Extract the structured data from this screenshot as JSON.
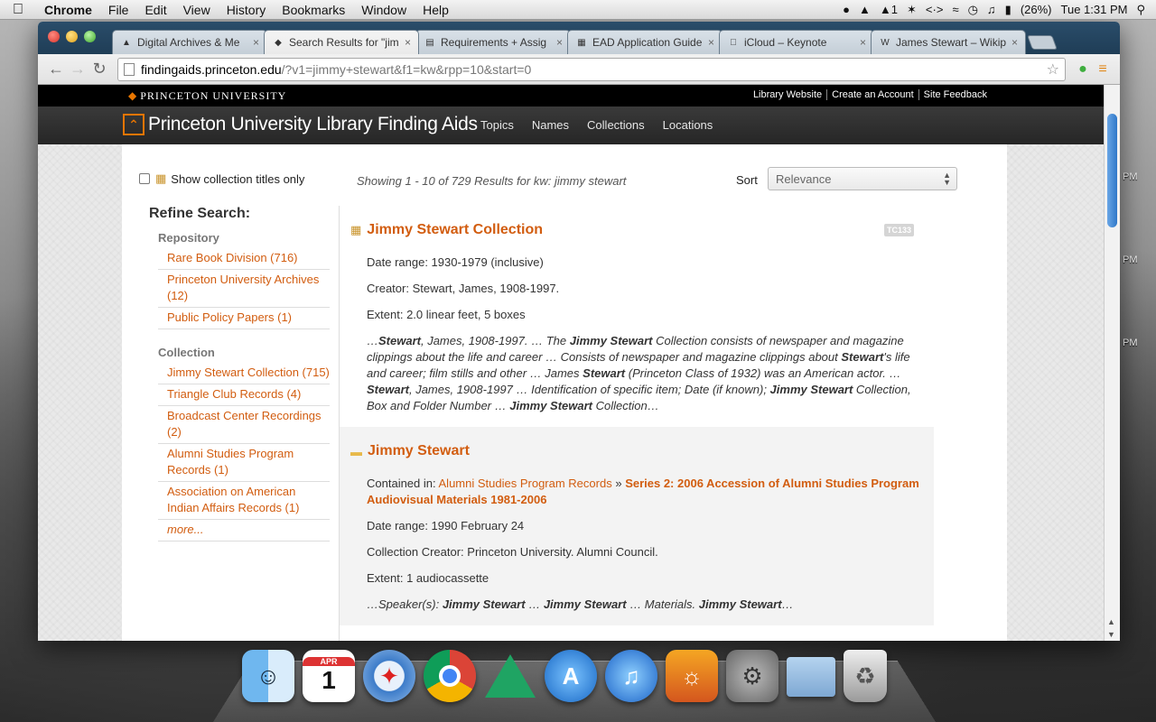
{
  "menubar": {
    "app": "Chrome",
    "items": [
      "File",
      "Edit",
      "View",
      "History",
      "Bookmarks",
      "Window",
      "Help"
    ],
    "status": {
      "adobe_count": "1",
      "battery": "(26%)",
      "clock": "Tue 1:31 PM"
    }
  },
  "browser": {
    "tabs": [
      {
        "label": "Digital Archives & Me",
        "icon": "drive-icon",
        "active": false
      },
      {
        "label": "Search Results for \"jim",
        "icon": "princeton-icon",
        "active": true
      },
      {
        "label": "Requirements + Assig",
        "icon": "doc-icon",
        "active": false
      },
      {
        "label": "EAD Application Guide",
        "icon": "ead-icon",
        "active": false
      },
      {
        "label": "iCloud – Keynote",
        "icon": "apple-icon",
        "active": false
      },
      {
        "label": "James Stewart – Wikip",
        "icon": "wikipedia-icon",
        "active": false
      }
    ],
    "url_host": "findingaids.princeton.edu",
    "url_rest": "/?v1=jimmy+stewart&f1=kw&rpp=10&start=0"
  },
  "site": {
    "university": "PRINCETON UNIVERSITY",
    "top_links": [
      "Library Website",
      "Create an Account",
      "Site Feedback"
    ],
    "title": "Princeton University Library Finding Aids",
    "nav": [
      "Topics",
      "Names",
      "Collections",
      "Locations"
    ]
  },
  "search": {
    "show_titles_label": "Show collection titles only",
    "showing": "Showing 1 - 10 of 729 Results for kw: jimmy stewart",
    "sort_label": "Sort",
    "sort_value": "Relevance"
  },
  "refine": {
    "title": "Refine Search:",
    "repository_head": "Repository",
    "repository": [
      "Rare Book Division (716)",
      "Princeton University Archives (12)",
      "Public Policy Papers (1)"
    ],
    "collection_head": "Collection",
    "collection": [
      "Jimmy Stewart Collection (715)",
      "Triangle Club Records (4)",
      "Broadcast Center Recordings (2)",
      "Alumni Studies Program Records (1)",
      "Association on American Indian Affairs Records (1)"
    ],
    "more": "more..."
  },
  "results": [
    {
      "title": "Jimmy Stewart Collection",
      "badge": "TC133",
      "date_range": "Date range: 1930-1979 (inclusive)",
      "creator": "Creator: Stewart, James, 1908-1997.",
      "extent": "Extent: 2.0 linear feet, 5 boxes",
      "snippet": [
        {
          "t": "…",
          "b": false
        },
        {
          "t": "Stewart",
          "b": true
        },
        {
          "t": ", James, 1908-1997. … The ",
          "b": false
        },
        {
          "t": "Jimmy Stewart",
          "b": true
        },
        {
          "t": " Collection consists of newspaper and magazine clippings about the life and career … Consists of newspaper and magazine clippings about ",
          "b": false
        },
        {
          "t": "Stewart",
          "b": true
        },
        {
          "t": "'s life and career; film stills and other … James ",
          "b": false
        },
        {
          "t": "Stewart",
          "b": true
        },
        {
          "t": " (Princeton Class of 1932) was an American actor. … ",
          "b": false
        },
        {
          "t": "Stewart",
          "b": true
        },
        {
          "t": ", James, 1908-1997 … Identification of specific item; Date (if known); ",
          "b": false
        },
        {
          "t": "Jimmy Stewart",
          "b": true
        },
        {
          "t": " Collection, Box and Folder Number … ",
          "b": false
        },
        {
          "t": "Jimmy Stewart",
          "b": true
        },
        {
          "t": " Collection…",
          "b": false
        }
      ]
    },
    {
      "title": "Jimmy Stewart",
      "contained_label": "Contained in: ",
      "contained_link": "Alumni Studies Program Records",
      "contained_sep": " » ",
      "contained_series": "Series 2: 2006 Accession of Alumni Studies Program Audiovisual Materials 1981-2006",
      "date_range": "Date range: 1990 February 24",
      "creator": "Collection Creator: Princeton University. Alumni Council.",
      "extent": "Extent: 1 audiocassette",
      "snippet": [
        {
          "t": "…Speaker(s): ",
          "b": false
        },
        {
          "t": "Jimmy Stewart",
          "b": true
        },
        {
          "t": " … ",
          "b": false
        },
        {
          "t": "Jimmy Stewart",
          "b": true
        },
        {
          "t": " … Materials. ",
          "b": false
        },
        {
          "t": "Jimmy Stewart",
          "b": true
        },
        {
          "t": "…",
          "b": false
        }
      ]
    }
  ],
  "desktop": {
    "side_labels": [
      "PM",
      "PM",
      "PM"
    ],
    "calendar_month": "APR",
    "calendar_day": "1"
  },
  "colors": {
    "accent": "#d25d10",
    "princeton_orange": "#e77500"
  }
}
